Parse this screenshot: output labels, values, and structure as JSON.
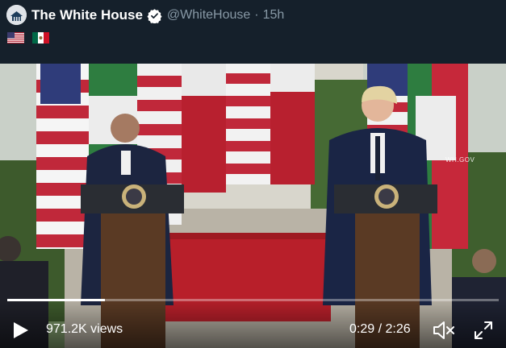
{
  "tweet": {
    "display_name": "The White House",
    "handle": "@WhiteHouse",
    "separator": "·",
    "time": "15h",
    "flags": [
      "us-flag-emoji",
      "mexico-flag-emoji"
    ]
  },
  "video": {
    "views": "971.2K views",
    "current_time": "0:29",
    "time_separator": "/",
    "duration": "2:26",
    "progress": 0.199,
    "watermark": "WH.GOV"
  },
  "colors": {
    "background": "#15202b",
    "secondary_text": "#8899a6",
    "verified": "#ffffff"
  },
  "icons": {
    "verified": "verified-badge-icon",
    "play": "play-icon",
    "mute": "muted-speaker-icon",
    "fullscreen": "fullscreen-icon"
  }
}
